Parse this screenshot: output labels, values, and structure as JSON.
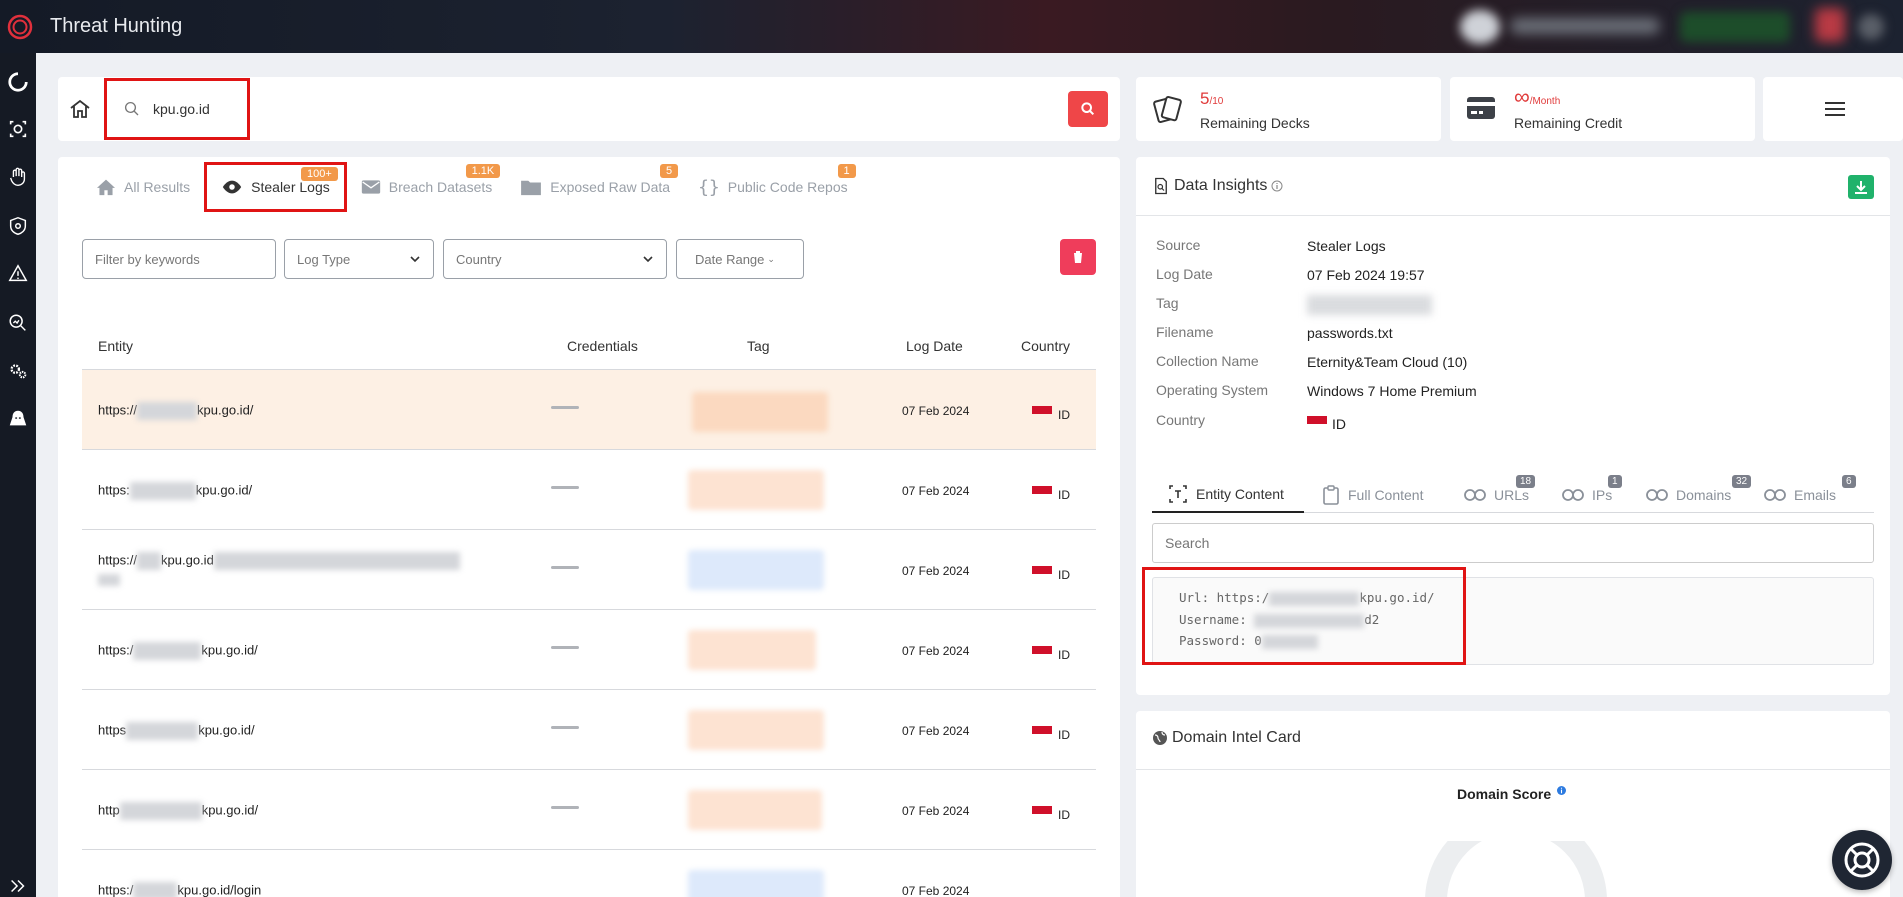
{
  "app": {
    "title": "Threat Hunting"
  },
  "search": {
    "value": "kpu.go.id"
  },
  "decks": {
    "count": "5",
    "total": "/10",
    "label": "Remaining Decks"
  },
  "credit": {
    "unit": "/Month",
    "label": "Remaining Credit"
  },
  "tabs": [
    {
      "label": "All Results",
      "badge": ""
    },
    {
      "label": "Stealer Logs",
      "badge": "100+"
    },
    {
      "label": "Breach Datasets",
      "badge": "1.1K"
    },
    {
      "label": "Exposed Raw Data",
      "badge": "5"
    },
    {
      "label": "Public Code Repos",
      "badge": "1"
    }
  ],
  "filters": {
    "keywords_placeholder": "Filter by keywords",
    "log_type": "Log Type",
    "country": "Country",
    "date_range": "Date Range"
  },
  "table": {
    "headers": {
      "entity": "Entity",
      "credentials": "Credentials",
      "tag": "Tag",
      "log_date": "Log Date",
      "country": "Country"
    },
    "rows": [
      {
        "entity_prefix": "https://",
        "entity_suffix": "kpu.go.id/",
        "date": "07 Feb 2024",
        "country": "ID"
      },
      {
        "entity_prefix": "https:",
        "entity_suffix": "kpu.go.id/",
        "date": "07 Feb 2024",
        "country": "ID"
      },
      {
        "entity_prefix": "https://",
        "entity_suffix": "kpu.go.id",
        "date": "07 Feb 2024",
        "country": "ID"
      },
      {
        "entity_prefix": "https:/",
        "entity_suffix": "kpu.go.id/",
        "date": "07 Feb 2024",
        "country": "ID"
      },
      {
        "entity_prefix": "https",
        "entity_suffix": "kpu.go.id/",
        "date": "07 Feb 2024",
        "country": "ID"
      },
      {
        "entity_prefix": "http",
        "entity_suffix": "kpu.go.id/",
        "date": "07 Feb 2024",
        "country": "ID"
      },
      {
        "entity_prefix": "https:/",
        "entity_suffix": "kpu.go.id/login",
        "date": "07 Feb 2024",
        "country": ""
      }
    ]
  },
  "insights": {
    "title": "Data Insights",
    "fields": [
      {
        "label": "Source",
        "value": "Stealer Logs"
      },
      {
        "label": "Log Date",
        "value": "07 Feb 2024 19:57"
      },
      {
        "label": "Tag",
        "value": ""
      },
      {
        "label": "Filename",
        "value": "passwords.txt"
      },
      {
        "label": "Collection Name",
        "value": "Eternity&Team Cloud (10)"
      },
      {
        "label": "Operating System",
        "value": "Windows 7 Home Premium"
      },
      {
        "label": "Country",
        "value": "ID"
      }
    ],
    "subtabs": [
      {
        "label": "Entity Content",
        "count": ""
      },
      {
        "label": "Full Content",
        "count": ""
      },
      {
        "label": "URLs",
        "count": "18"
      },
      {
        "label": "IPs",
        "count": "1"
      },
      {
        "label": "Domains",
        "count": "32"
      },
      {
        "label": "Emails",
        "count": "6"
      }
    ],
    "search_placeholder": "Search",
    "content": {
      "url_prefix": "Url: https:/",
      "url_suffix": "kpu.go.id/",
      "username_prefix": "Username:",
      "username_suffix": "d2",
      "password_prefix": "Password: 0"
    }
  },
  "domain_intel": {
    "title": "Domain Intel Card",
    "score_label": "Domain Score"
  },
  "colors": {
    "accent_red": "#ef4648",
    "badge_orange": "#f2994a",
    "green": "#20b26b",
    "sidebar": "#151a24"
  }
}
